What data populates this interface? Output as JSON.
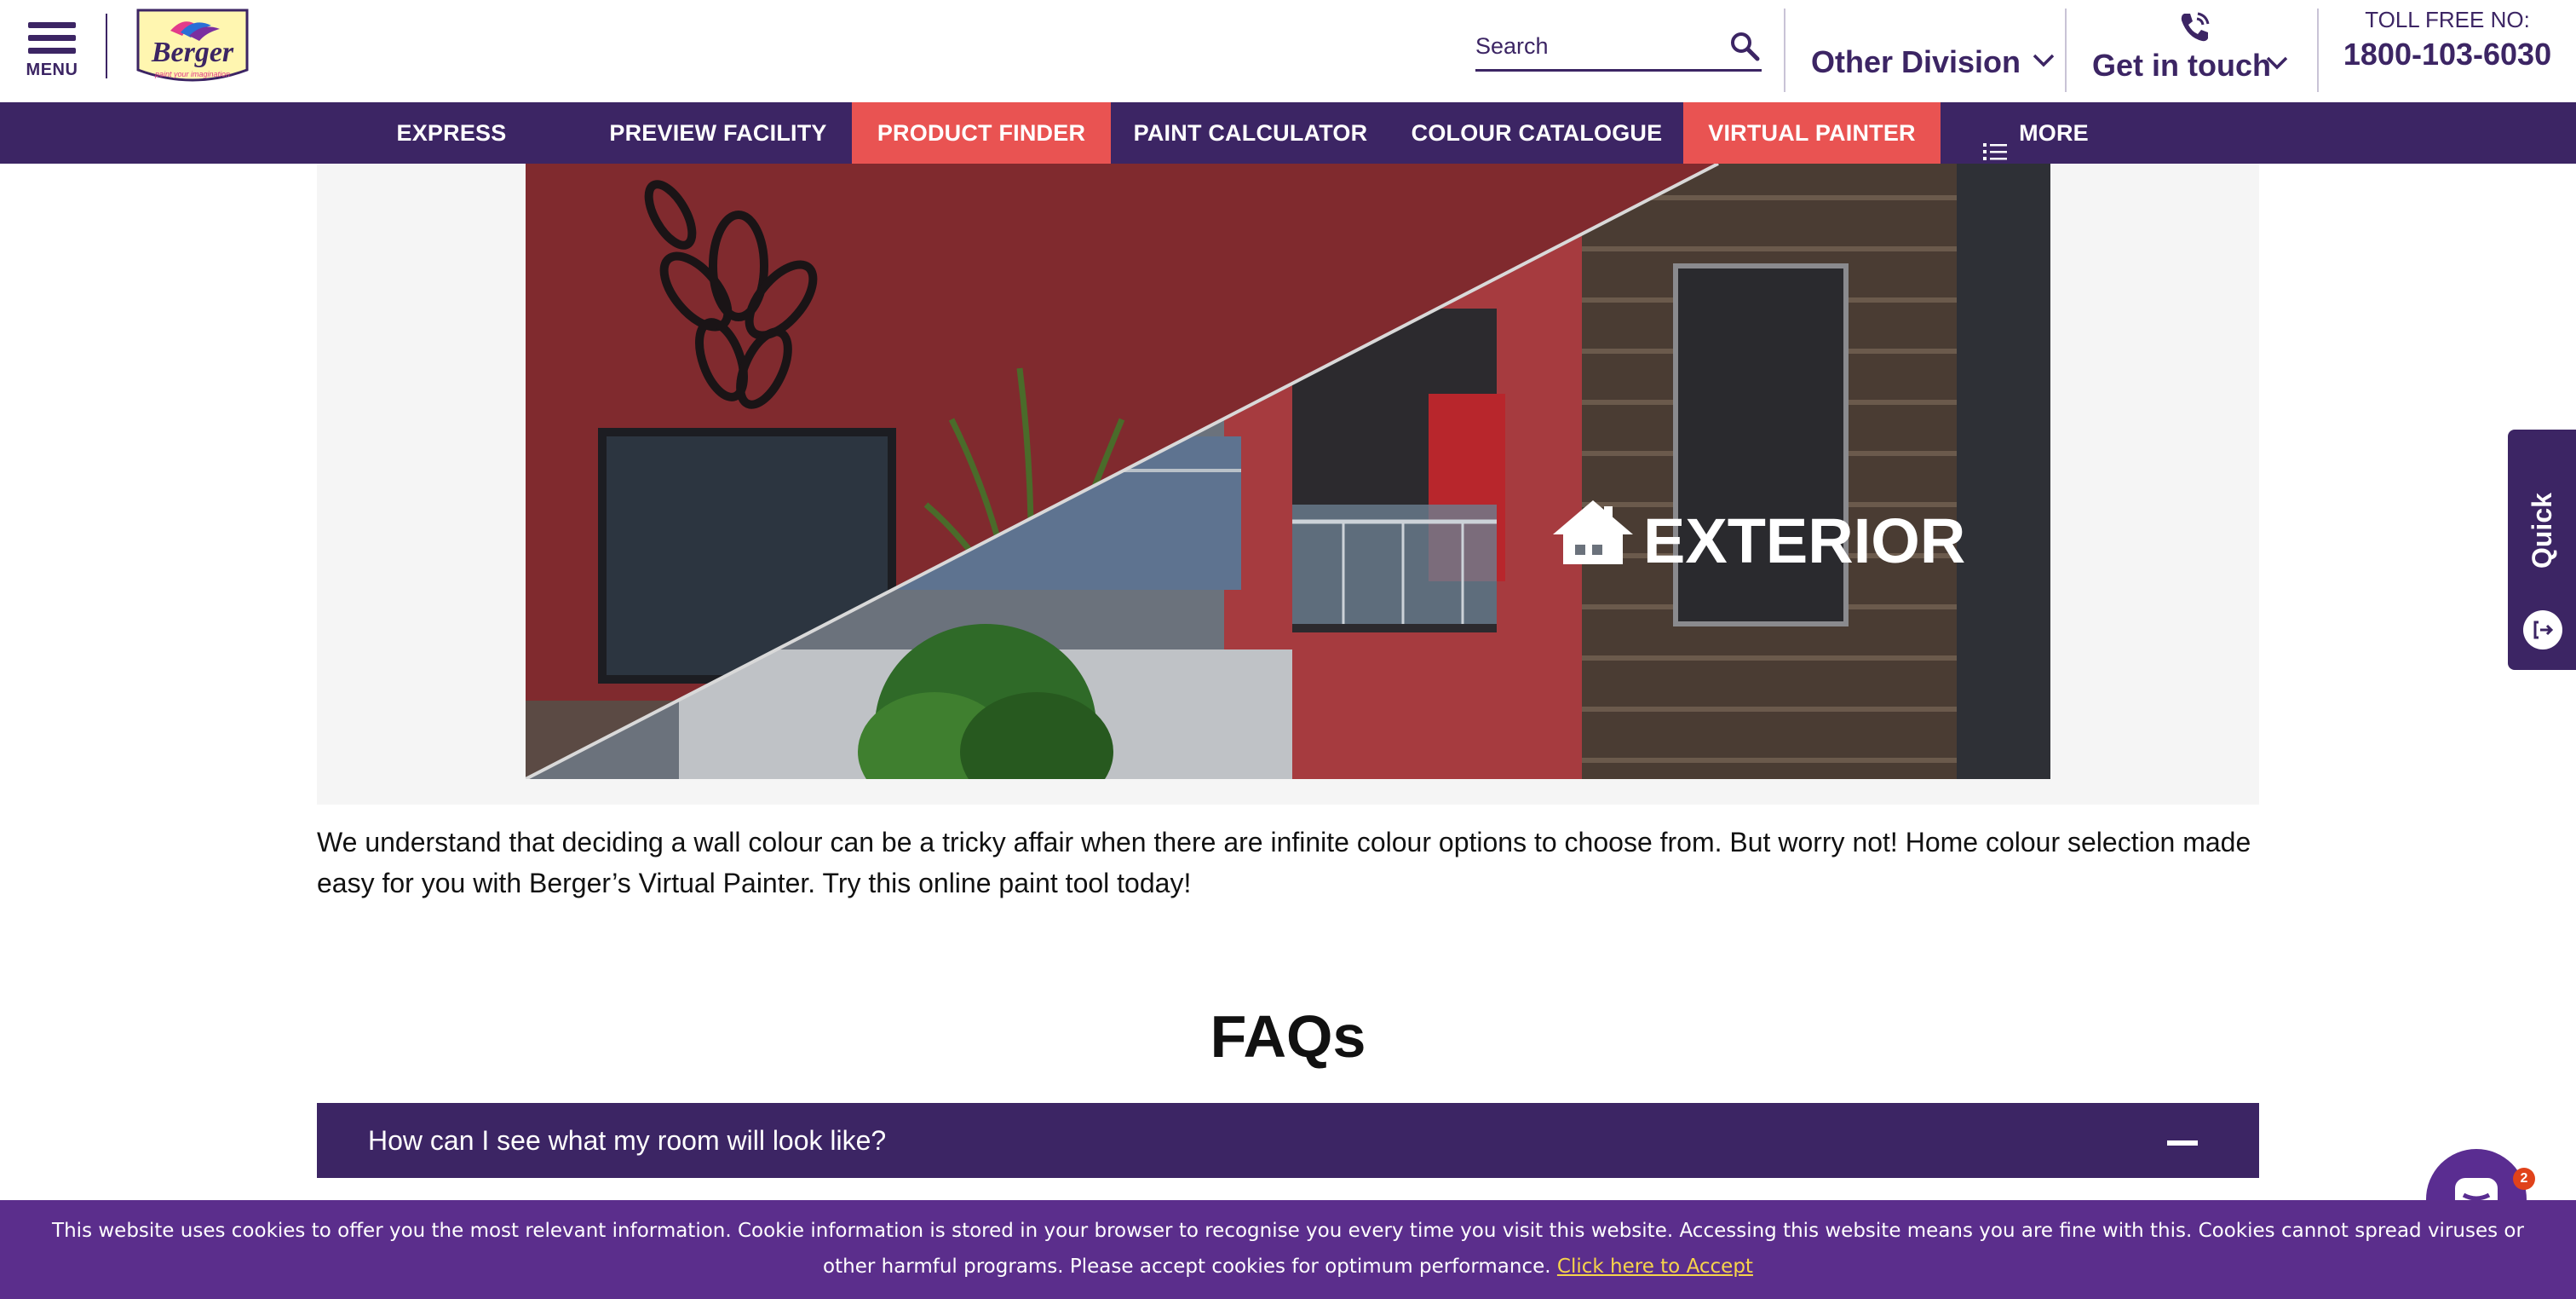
{
  "header": {
    "menu_label": "MENU",
    "logo": {
      "name": "Berger",
      "tagline": "paint your imagination",
      "since": "Since 1760"
    },
    "search": {
      "placeholder": "Search",
      "value": ""
    },
    "other_division": "Other Division",
    "get_in_touch": "Get in touch",
    "toll_free_label": "TOLL FREE NO:",
    "toll_free_number": "1800-103-6030"
  },
  "nav": {
    "items": [
      {
        "label": "EXPRESS PAINTING",
        "active": false
      },
      {
        "label": "PREVIEW FACILITY",
        "active": false
      },
      {
        "label": "PRODUCT FINDER",
        "active": true
      },
      {
        "label": "PAINT CALCULATOR",
        "active": false
      },
      {
        "label": "COLOUR CATALOGUE",
        "active": false
      },
      {
        "label": "VIRTUAL PAINTER",
        "active": true
      },
      {
        "label": "MORE",
        "active": false
      }
    ]
  },
  "hero": {
    "exterior_label": "EXTERIOR"
  },
  "description": "We understand that deciding a wall colour can be a tricky affair when there are infinite colour options to choose from. But worry not! Home colour selection made easy for you with Berger’s Virtual Painter. Try this online paint tool today!",
  "faq": {
    "title": "FAQs",
    "items": [
      {
        "question": "How can I see what my room will look like?",
        "expanded": true
      }
    ]
  },
  "quick_links": {
    "label": "Quick Links"
  },
  "chat": {
    "badge_count": "2"
  },
  "cookie": {
    "message": "This website uses cookies to offer you the most relevant information. Cookie information is stored in your browser to recognise you every time you visit this website. Accessing this website means you are fine with this. Cookies cannot spread viruses or other harmful programs. Please accept cookies for optimum performance.",
    "accept_label": "Click here to Accept"
  },
  "colors": {
    "brand_purple": "#3c2564",
    "active_coral": "#e95352",
    "cookie_purple": "#5b2e8c",
    "accept_yellow": "#f7d44a"
  }
}
